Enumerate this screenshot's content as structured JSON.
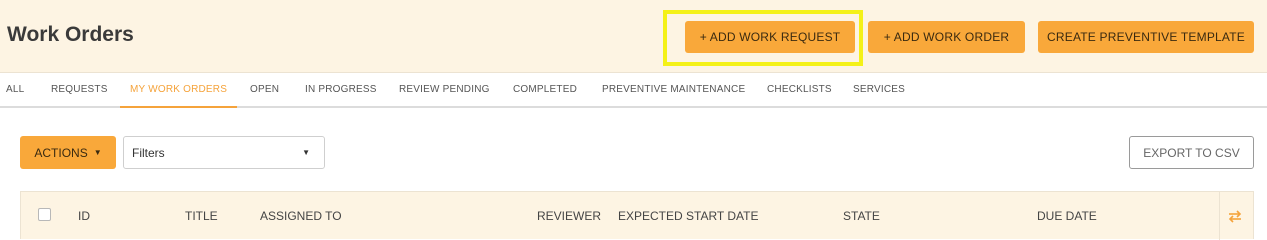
{
  "header": {
    "title": "Work Orders",
    "buttons": {
      "add_work_request": "+ ADD WORK REQUEST",
      "add_work_order": "+ ADD WORK ORDER",
      "create_preventive_template": "CREATE PREVENTIVE TEMPLATE"
    }
  },
  "tabs": [
    {
      "label": "ALL"
    },
    {
      "label": "REQUESTS"
    },
    {
      "label": "MY WORK ORDERS",
      "active": true
    },
    {
      "label": "OPEN"
    },
    {
      "label": "IN PROGRESS"
    },
    {
      "label": "REVIEW PENDING"
    },
    {
      "label": "COMPLETED"
    },
    {
      "label": "PREVENTIVE MAINTENANCE"
    },
    {
      "label": "CHECKLISTS"
    },
    {
      "label": "SERVICES"
    }
  ],
  "toolbar": {
    "actions_label": "ACTIONS",
    "filters_value": "Filters",
    "export_label": "EXPORT TO CSV"
  },
  "table": {
    "columns": [
      "ID",
      "TITLE",
      "ASSIGNED TO",
      "REVIEWER",
      "EXPECTED START DATE",
      "STATE",
      "DUE DATE"
    ]
  },
  "icons": {
    "actions_caret": "caret-down-icon",
    "filters_caret": "caret-down-icon",
    "column_settings": "column-settings-icon"
  },
  "colors": {
    "accent": "#f9a83a",
    "header_bg": "#fdf4e3",
    "active_tab": "#f5a33b",
    "highlight": "#f4f118"
  }
}
